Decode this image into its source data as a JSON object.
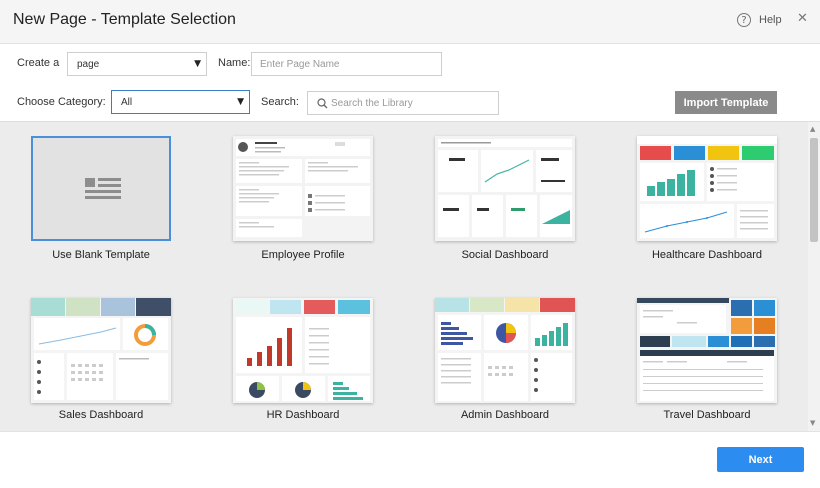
{
  "dialog": {
    "title": "New Page - Template Selection",
    "help_label": "Help"
  },
  "form": {
    "create_label": "Create a",
    "create_value": "page",
    "name_label": "Name:",
    "name_placeholder": "Enter Page Name",
    "category_label": "Choose Category:",
    "category_value": "All",
    "search_label": "Search:",
    "search_placeholder": "Search the Library",
    "import_label": "Import Template"
  },
  "templates": [
    {
      "label": "Use Blank Template"
    },
    {
      "label": "Employee Profile"
    },
    {
      "label": "Social Dashboard"
    },
    {
      "label": "Healthcare Dashboard"
    },
    {
      "label": "Sales Dashboard"
    },
    {
      "label": "HR Dashboard"
    },
    {
      "label": "Admin Dashboard"
    },
    {
      "label": "Travel Dashboard"
    }
  ],
  "footer": {
    "next_label": "Next"
  },
  "colors": {
    "accent": "#2d8cf0",
    "selected_border": "#4a8fd9",
    "import_button": "#8a8a8a"
  }
}
